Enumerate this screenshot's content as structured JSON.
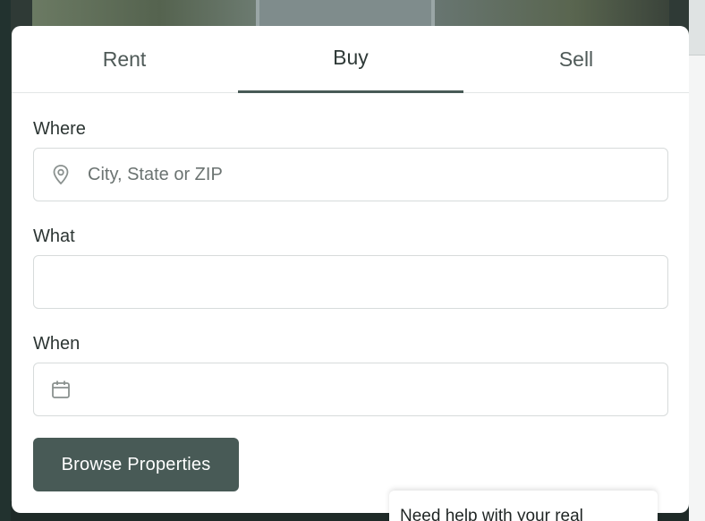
{
  "tabs": [
    {
      "label": "Rent"
    },
    {
      "label": "Buy",
      "active": true
    },
    {
      "label": "Sell"
    }
  ],
  "form": {
    "where": {
      "label": "Where",
      "placeholder": "City, State or ZIP",
      "value": "",
      "icon": "map-pin-icon"
    },
    "what": {
      "label": "What",
      "placeholder": "",
      "value": ""
    },
    "when": {
      "label": "When",
      "placeholder": "",
      "value": "",
      "icon": "calendar-icon"
    },
    "submit_label": "Browse Properties"
  },
  "chat_prompt": "Need help with your real",
  "colors": {
    "accent": "#485a56",
    "tab_active_underline": "#485a56",
    "input_border": "#d7dbdb",
    "text": "#2c3533"
  }
}
